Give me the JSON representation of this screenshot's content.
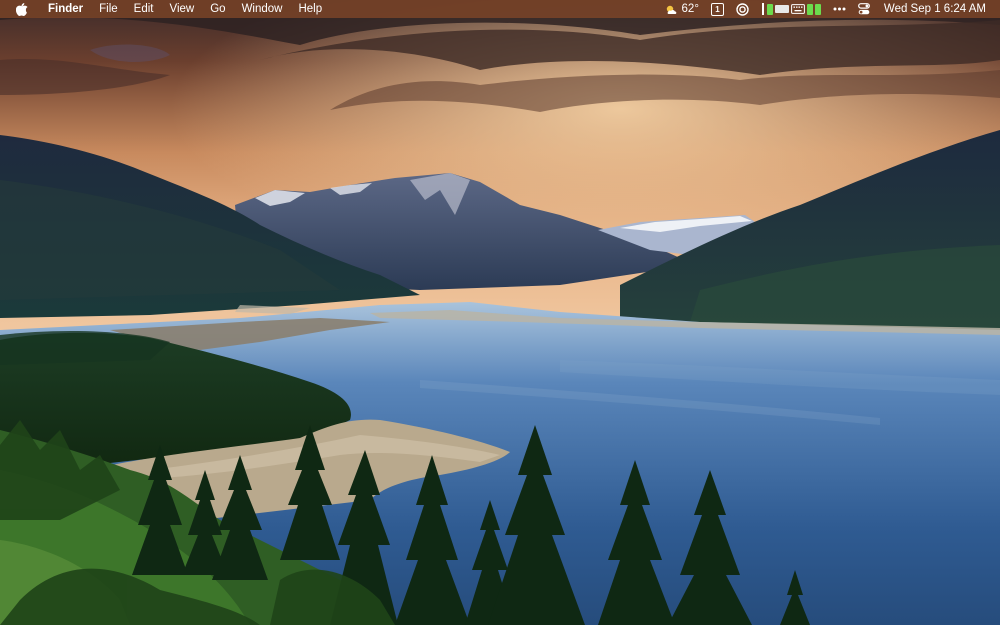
{
  "menubar": {
    "apple_menu_icon": "apple-logo",
    "app_name": "Finder",
    "menus": [
      "File",
      "Edit",
      "View",
      "Go",
      "Window",
      "Help"
    ],
    "status": {
      "weather_icon": "partly-sunny-icon",
      "temperature": "62°",
      "calendar_day": "1",
      "focus_icon": "circle-record-icon",
      "stats_icon": "system-monitor-icon",
      "keyboard_icon": "keyboard-icon",
      "more_icon": "ellipsis-icon",
      "control_center_icon": "toggles-icon",
      "datetime": "Wed Sep 1  6:24 AM"
    }
  },
  "desktop": {
    "wallpaper": "mountain-lake-sunset",
    "colors": {
      "menubar_bg": "#824628",
      "meter_green": "#6cdb4d"
    }
  }
}
